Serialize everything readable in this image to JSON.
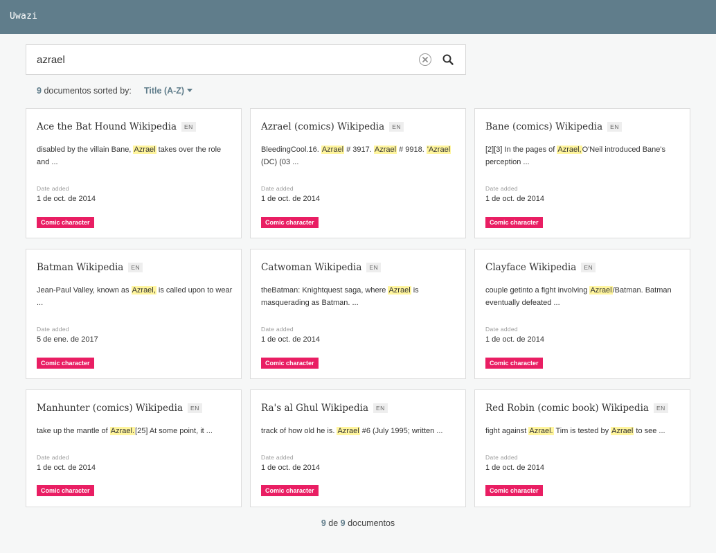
{
  "app": {
    "name": "Uwazi"
  },
  "search": {
    "value": "azrael"
  },
  "icons": {
    "clear": "clear-circle-icon",
    "search": "magnifier-icon",
    "sort": "caret-down-icon"
  },
  "colors": {
    "header": "#607d8b",
    "tag": "#e91e63",
    "highlight": "#fff59d"
  },
  "summary": {
    "count": "9",
    "label": "documentos sorted by:",
    "sort_value": "Title (A-Z)"
  },
  "documents": [
    {
      "title": "Ace the Bat Hound Wikipedia",
      "lang": "EN",
      "snippet": [
        {
          "t": "disabled by the villain Bane, "
        },
        {
          "h": "Azrael"
        },
        {
          "t": " takes over the role and ..."
        }
      ],
      "date_label": "Date added",
      "date": "1 de oct. de 2014",
      "tag": "Comic character"
    },
    {
      "title": "Azrael (comics) Wikipedia",
      "lang": "EN",
      "snippet": [
        {
          "t": "BleedingCool.16. "
        },
        {
          "h": "Azrael"
        },
        {
          "t": " # 3917. "
        },
        {
          "h": "Azrael"
        },
        {
          "t": " # 9918. "
        },
        {
          "h": "'Azrael"
        },
        {
          "t": " (DC) (03 ..."
        }
      ],
      "date_label": "Date added",
      "date": "1 de oct. de 2014",
      "tag": "Comic character"
    },
    {
      "title": "Bane (comics) Wikipedia",
      "lang": "EN",
      "snippet": [
        {
          "t": "[2][3] In the pages of "
        },
        {
          "h": "Azrael,"
        },
        {
          "t": "O'Neil introduced Bane's perception ..."
        }
      ],
      "date_label": "Date added",
      "date": "1 de oct. de 2014",
      "tag": "Comic character"
    },
    {
      "title": "Batman Wikipedia",
      "lang": "EN",
      "snippet": [
        {
          "t": "Jean-Paul Valley, known as "
        },
        {
          "h": "Azrael,"
        },
        {
          "t": " is called upon to wear ..."
        }
      ],
      "date_label": "Date added",
      "date": "5 de ene. de 2017",
      "tag": "Comic character"
    },
    {
      "title": "Catwoman Wikipedia",
      "lang": "EN",
      "snippet": [
        {
          "t": "theBatman: Knightquest saga, where "
        },
        {
          "h": "Azrael"
        },
        {
          "t": " is masquerading as Batman. ..."
        }
      ],
      "date_label": "Date added",
      "date": "1 de oct. de 2014",
      "tag": "Comic character"
    },
    {
      "title": "Clayface Wikipedia",
      "lang": "EN",
      "snippet": [
        {
          "t": "couple getinto a fight involving "
        },
        {
          "h": "Azrael"
        },
        {
          "t": "/Batman. Batman eventually defeated ..."
        }
      ],
      "date_label": "Date added",
      "date": "1 de oct. de 2014",
      "tag": "Comic character"
    },
    {
      "title": "Manhunter (comics) Wikipedia",
      "lang": "EN",
      "snippet": [
        {
          "t": "take up the mantle of "
        },
        {
          "h": "Azrael."
        },
        {
          "t": "[25] At some point, it ..."
        }
      ],
      "date_label": "Date added",
      "date": "1 de oct. de 2014",
      "tag": "Comic character"
    },
    {
      "title": "Ra's al Ghul Wikipedia",
      "lang": "EN",
      "snippet": [
        {
          "t": "track of how old he is. "
        },
        {
          "h": "Azrael"
        },
        {
          "t": " #6 (July 1995; written ..."
        }
      ],
      "date_label": "Date added",
      "date": "1 de oct. de 2014",
      "tag": "Comic character"
    },
    {
      "title": "Red Robin (comic book) Wikipedia",
      "lang": "EN",
      "snippet": [
        {
          "t": "fight against "
        },
        {
          "h": "Azrael."
        },
        {
          "t": " Tim is tested by "
        },
        {
          "h": "Azrael"
        },
        {
          "t": " to see ..."
        }
      ],
      "date_label": "Date added",
      "date": "1 de oct. de 2014",
      "tag": "Comic character"
    }
  ],
  "footer": {
    "shown": "9",
    "of": "de",
    "total": "9",
    "label": "documentos"
  }
}
